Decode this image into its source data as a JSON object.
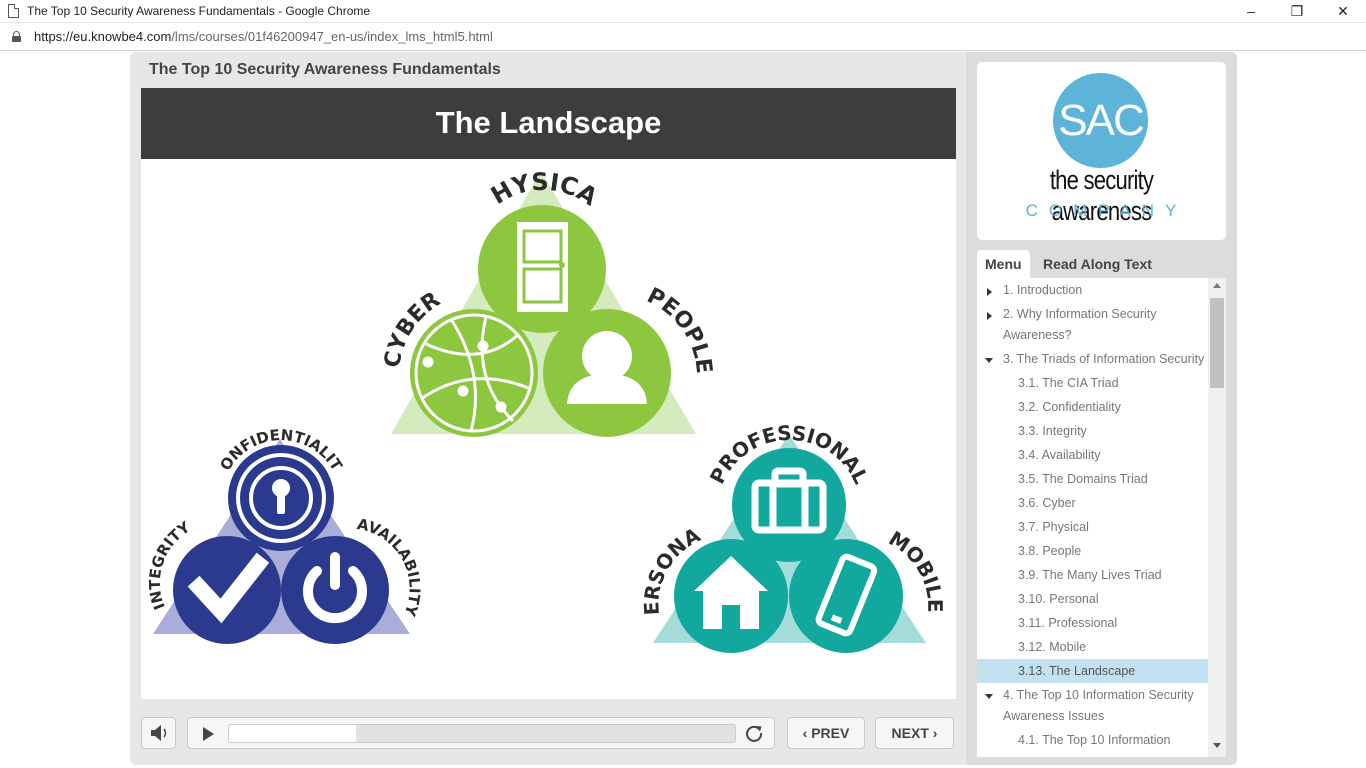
{
  "browser": {
    "window_title": "The Top 10 Security Awareness Fundamentals - Google Chrome",
    "url_host": "https://eu.knowbe4.com",
    "url_path": "/lms/courses/01f46200947_en-us/index_lms_html5.html",
    "minimize_glyph": "–",
    "restore_glyph": "❐",
    "close_glyph": "✕"
  },
  "course": {
    "title": "The Top 10 Security Awareness Fundamentals"
  },
  "slide": {
    "title": "The Landscape",
    "triads": {
      "domains": {
        "top": "PHYSICAL",
        "left": "CYBER",
        "right": "PEOPLE",
        "color": "#8dc63f",
        "bg": "#d6ebbd"
      },
      "cia": {
        "top": "CONFIDENTIALITY",
        "left": "INTEGRITY",
        "right": "AVAILABILITY",
        "color": "#2b3a8f",
        "bg": "#a9add7"
      },
      "lives": {
        "top": "PROFESSIONAL",
        "left": "PERSONAL",
        "right": "MOBILE",
        "color": "#13a89e",
        "bg": "#a4dcd9"
      }
    }
  },
  "controls": {
    "prev_label": "PREV",
    "next_label": "NEXT",
    "progress_fraction": 0.25
  },
  "sidebar": {
    "logo": {
      "mark": "SAC",
      "name": "the security awareness",
      "sub": "COMPANY"
    },
    "tabs": [
      "Menu",
      "Read Along Text"
    ],
    "menu": [
      {
        "label": "1. Introduction",
        "level": 1,
        "caret": "right"
      },
      {
        "label": "2. Why Information Security Awareness?",
        "level": 1,
        "caret": "right"
      },
      {
        "label": "3. The Triads of Information Security",
        "level": 1,
        "caret": "down"
      },
      {
        "label": "3.1. The CIA Triad",
        "level": 2
      },
      {
        "label": "3.2. Confidentiality",
        "level": 2
      },
      {
        "label": "3.3. Integrity",
        "level": 2
      },
      {
        "label": "3.4. Availability",
        "level": 2
      },
      {
        "label": "3.5. The Domains Triad",
        "level": 2
      },
      {
        "label": "3.6. Cyber",
        "level": 2
      },
      {
        "label": "3.7. Physical",
        "level": 2
      },
      {
        "label": "3.8. People",
        "level": 2
      },
      {
        "label": "3.9. The Many Lives Triad",
        "level": 2
      },
      {
        "label": "3.10. Personal",
        "level": 2
      },
      {
        "label": "3.11. Professional",
        "level": 2
      },
      {
        "label": "3.12. Mobile",
        "level": 2
      },
      {
        "label": "3.13. The Landscape",
        "level": 2,
        "active": true
      },
      {
        "label": "4. The Top 10 Information Security Awareness Issues",
        "level": 1,
        "caret": "down"
      },
      {
        "label": "4.1. The Top 10 Information",
        "level": 2
      }
    ]
  }
}
